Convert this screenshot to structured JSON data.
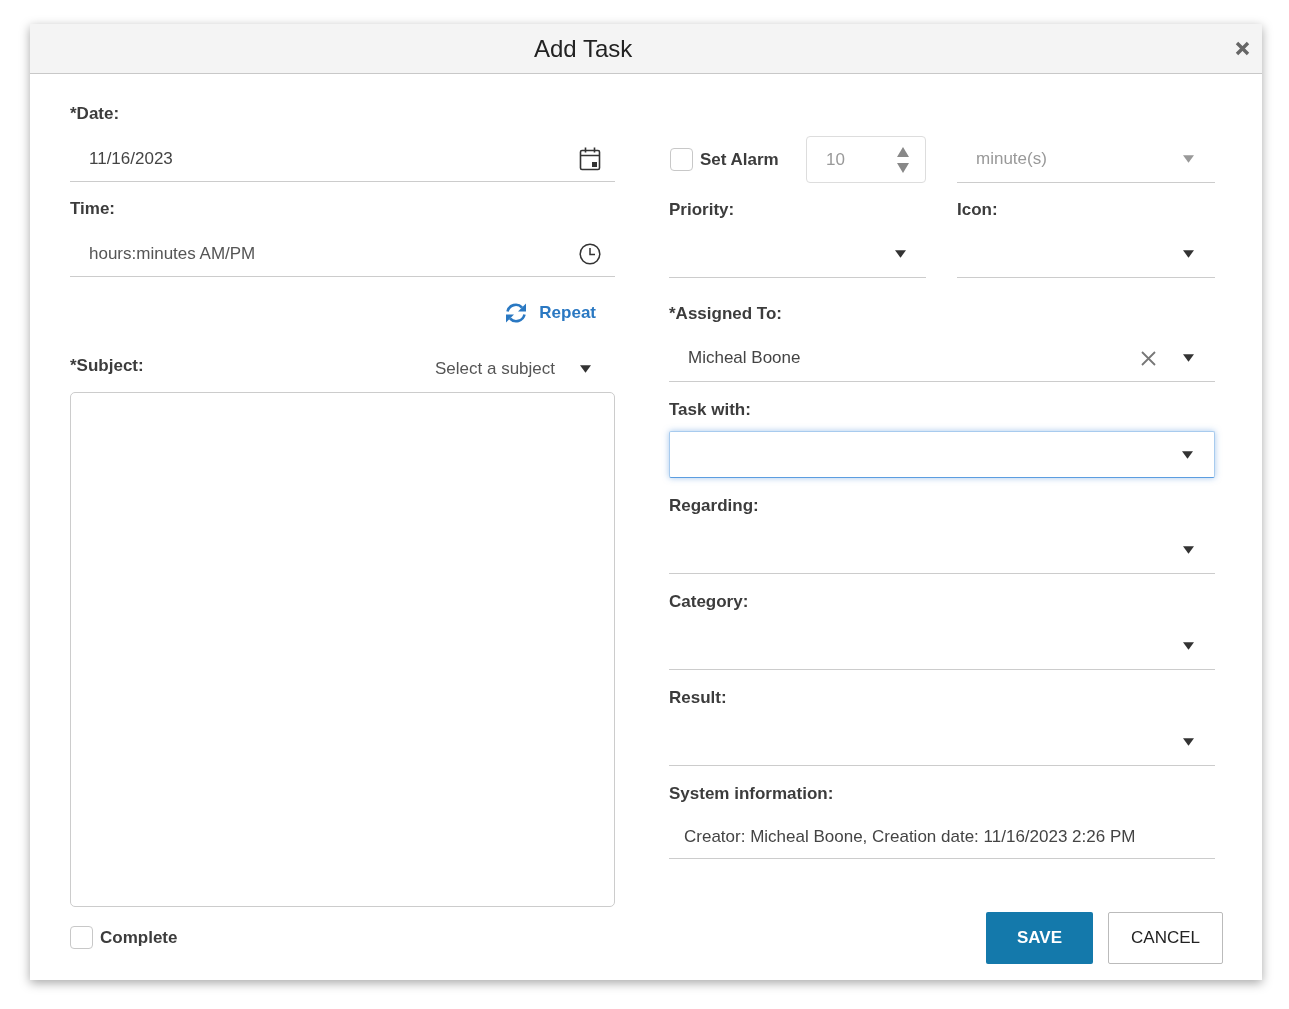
{
  "dialog": {
    "title": "Add Task"
  },
  "left": {
    "date": {
      "label": "*Date:",
      "value": "11/16/2023"
    },
    "time": {
      "label": "Time:",
      "placeholder": "hours:minutes AM/PM"
    },
    "repeat": {
      "label": "Repeat"
    },
    "subject": {
      "label": "*Subject:",
      "placeholder": "Select a subject"
    },
    "complete": {
      "label": "Complete",
      "checked": false
    }
  },
  "right": {
    "alarm": {
      "label": "Set Alarm",
      "checked": false,
      "amount": "10",
      "unit": "minute(s)",
      "disabled": true
    },
    "fields": [
      {
        "kind": "pair",
        "items": [
          {
            "label": "Priority:"
          },
          {
            "label": "Icon:"
          }
        ]
      },
      {
        "kind": "select",
        "label": "*Assigned To:",
        "value": "Micheal Boone",
        "focused": false
      },
      {
        "kind": "select",
        "label": "Task with:",
        "focused": true
      },
      {
        "kind": "select",
        "label": "Regarding:",
        "focused": false
      },
      {
        "kind": "select",
        "label": "Category:",
        "focused": false
      },
      {
        "kind": "select",
        "label": "Result:",
        "focused": false
      },
      {
        "kind": "text",
        "label": "System information:",
        "value": "Creator: Micheal Boone, Creation date: 11/16/2023 2:26 PM"
      }
    ]
  },
  "buttons": [
    {
      "label": "SAVE",
      "kind": "primary"
    },
    {
      "label": "CANCEL",
      "kind": "secondary"
    }
  ]
}
